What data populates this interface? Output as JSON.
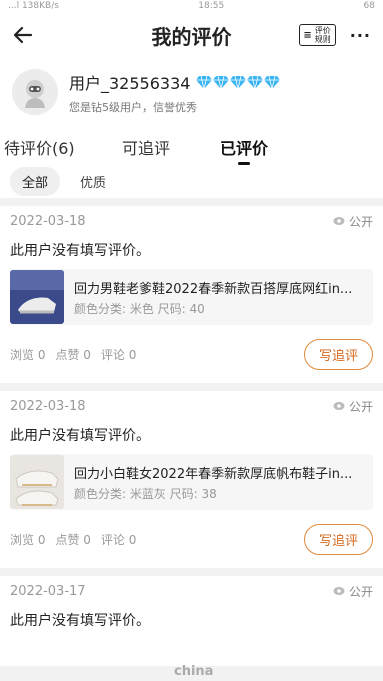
{
  "status_bar": {
    "left": "...l 138KB/s",
    "center": "18:55",
    "right": "68"
  },
  "header": {
    "title": "我的评价",
    "rules_label": "评价规则",
    "rules_mark": "≡",
    "more": "···"
  },
  "profile": {
    "username": "用户_32556334",
    "tip": "您是钻5级用户，信誉优秀",
    "diamond_count": 5,
    "diamond_color": "#3ab4f2"
  },
  "tabs": [
    {
      "label": "待评价(6)"
    },
    {
      "label": "可追评"
    },
    {
      "label": "已评价"
    }
  ],
  "filters": [
    {
      "label": "全部"
    },
    {
      "label": "优质"
    }
  ],
  "reviews": [
    {
      "date": "2022-03-18",
      "visibility": "公开",
      "comment": "此用户没有填写评价。",
      "product_name": "回力男鞋老爹鞋2022春季新款百搭厚底网红in...",
      "product_spec": "颜色分类: 米色  尺码: 40",
      "stats": [
        "浏览 0",
        "点赞 0",
        "评论 0"
      ],
      "action": "写追评"
    },
    {
      "date": "2022-03-18",
      "visibility": "公开",
      "comment": "此用户没有填写评价。",
      "product_name": "回力小白鞋女2022年春季新款厚底帆布鞋子in...",
      "product_spec": "颜色分类: 米蓝灰  尺码: 38",
      "stats": [
        "浏览 0",
        "点赞 0",
        "评论 0"
      ],
      "action": "写追评"
    },
    {
      "date": "2022-03-17",
      "visibility": "公开",
      "comment": "此用户没有填写评价。"
    }
  ],
  "accent_color": "#e08a3c",
  "watermark": "china"
}
